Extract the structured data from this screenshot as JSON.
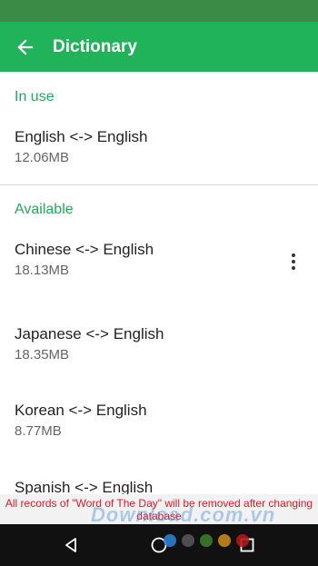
{
  "app_bar": {
    "title": "Dictionary"
  },
  "sections": {
    "in_use": {
      "header": "In use",
      "items": [
        {
          "name": "English <-> English",
          "size": "12.06MB"
        }
      ]
    },
    "available": {
      "header": "Available",
      "items": [
        {
          "name": "Chinese <-> English",
          "size": "18.13MB"
        },
        {
          "name": "Japanese <-> English",
          "size": "18.35MB"
        },
        {
          "name": "Korean <-> English",
          "size": "8.77MB"
        },
        {
          "name": "Spanish <-> English",
          "size": ""
        }
      ]
    }
  },
  "toast": {
    "message": "All records of \"Word of The Day\" will be removed after changing database"
  },
  "watermark": {
    "text": "Download.com.vn"
  },
  "colors": {
    "status_bar": "#3b8a45",
    "app_bar": "#21b35a",
    "section_header": "#21a85a",
    "toast_text": "#d81b2a",
    "watermark_dots": [
      "#2a7fd0",
      "#555555",
      "#3a7d2a",
      "#c8871a",
      "#b01818"
    ]
  },
  "icons": {
    "back": "arrow-left-icon",
    "more": "more-vertical-icon",
    "nav_back": "triangle-back-icon",
    "nav_home": "circle-home-icon",
    "nav_recents": "square-recents-icon"
  }
}
